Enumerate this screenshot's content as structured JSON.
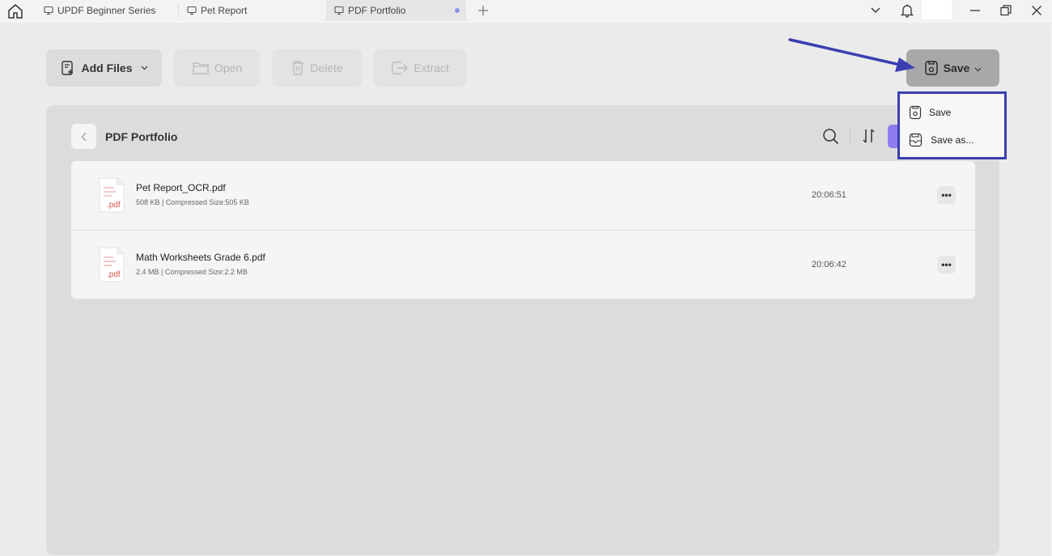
{
  "tabs": [
    {
      "label": "UPDF Beginner Series"
    },
    {
      "label": "Pet Report"
    },
    {
      "label": "PDF Portfolio"
    }
  ],
  "toolbar": {
    "add_files": "Add Files",
    "open": "Open",
    "delete": "Delete",
    "extract": "Extract",
    "save": "Save"
  },
  "panel": {
    "title": "PDF Portfolio"
  },
  "files": [
    {
      "name": "Pet Report_OCR.pdf",
      "meta": "508 KB | Compressed Size:505 KB",
      "time": "20:06:51",
      "ext": ".pdf"
    },
    {
      "name": "Math Worksheets Grade 6.pdf",
      "meta": "2.4 MB | Compressed Size:2.2 MB",
      "time": "20:06:42",
      "ext": ".pdf"
    }
  ],
  "save_menu": {
    "save": "Save",
    "save_as": "Save as..."
  },
  "colors": {
    "accent": "#3b3fb0",
    "toggle": "#8c7cf0",
    "pdf_red": "#d9534f"
  }
}
